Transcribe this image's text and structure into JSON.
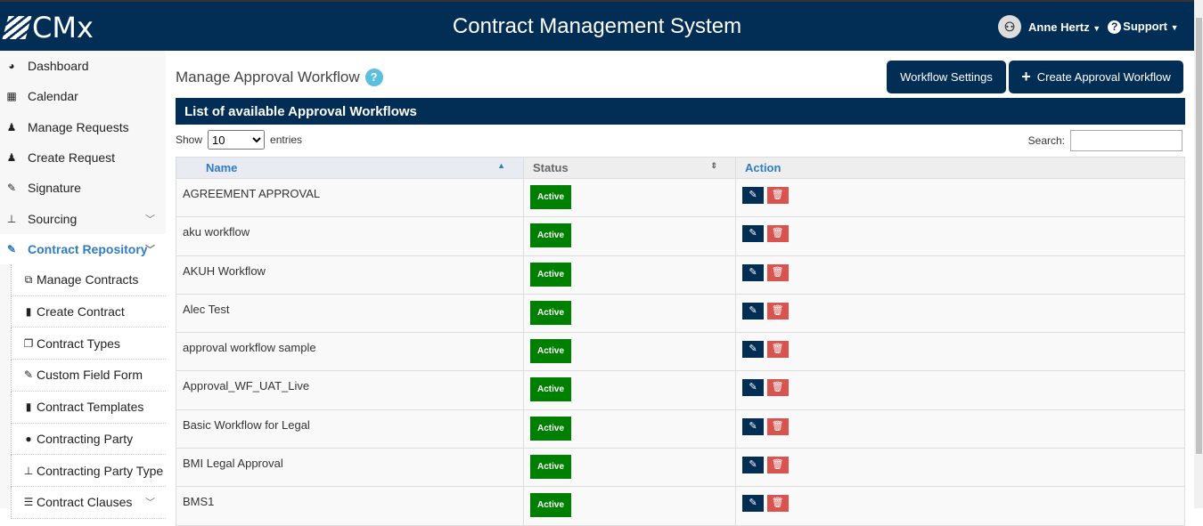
{
  "header": {
    "logo": "CMx",
    "title": "Contract Management System",
    "user": "Anne Hertz",
    "support": "Support"
  },
  "sidebar": {
    "items": [
      {
        "label": "Dashboard",
        "icon": "dashboard-icon",
        "glyph": "◕"
      },
      {
        "label": "Calendar",
        "icon": "calendar-icon",
        "glyph": "▦"
      },
      {
        "label": "Manage Requests",
        "icon": "user-tie-icon",
        "glyph": "♟"
      },
      {
        "label": "Create Request",
        "icon": "user-tie-icon",
        "glyph": "♟"
      },
      {
        "label": "Signature",
        "icon": "pencil-icon",
        "glyph": "✎"
      },
      {
        "label": "Sourcing",
        "icon": "sitemap-icon",
        "glyph": "⊥"
      },
      {
        "label": "Contract Repository",
        "icon": "edit-icon",
        "glyph": "✎"
      }
    ],
    "subitems": [
      {
        "label": "Manage Contracts",
        "glyph": "⧉"
      },
      {
        "label": "Create Contract",
        "glyph": "▮"
      },
      {
        "label": "Contract Types",
        "glyph": "❐"
      },
      {
        "label": "Custom Field Form",
        "glyph": "✎"
      },
      {
        "label": "Contract Templates",
        "glyph": "▮"
      },
      {
        "label": "Contracting Party",
        "glyph": "●"
      },
      {
        "label": "Contracting Party Type",
        "glyph": "⊥"
      },
      {
        "label": "Contract Clauses",
        "glyph": "☰"
      }
    ]
  },
  "page": {
    "title": "Manage Approval Workflow",
    "help": "?",
    "settings_btn": "Workflow Settings",
    "create_btn": "Create Approval Workflow",
    "panel_title": "List of available Approval Workflows",
    "show": "Show",
    "entries": "entries",
    "page_size": "10",
    "search_label": "Search:"
  },
  "table": {
    "headers": [
      "Name",
      "Status",
      "Action"
    ],
    "rows": [
      {
        "name": "AGREEMENT APPROVAL",
        "status": "Active"
      },
      {
        "name": "aku workflow",
        "status": "Active"
      },
      {
        "name": "AKUH Workflow",
        "status": "Active"
      },
      {
        "name": "Alec Test",
        "status": "Active"
      },
      {
        "name": "approval workflow sample",
        "status": "Active"
      },
      {
        "name": "Approval_WF_UAT_Live",
        "status": "Active"
      },
      {
        "name": "Basic Workflow for Legal",
        "status": "Active"
      },
      {
        "name": "BMI Legal Approval",
        "status": "Active"
      },
      {
        "name": "BMS1",
        "status": "Active"
      }
    ]
  }
}
